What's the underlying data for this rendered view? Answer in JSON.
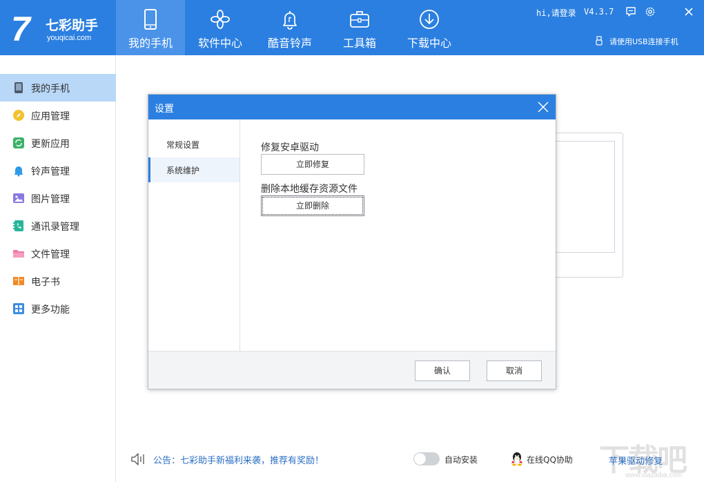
{
  "app": {
    "logo_mark": "7",
    "logo_name": "七彩助手",
    "logo_url": "youqicai.com"
  },
  "nav": [
    {
      "label": "我的手机",
      "icon": "phone-icon",
      "active": true
    },
    {
      "label": "软件中心",
      "icon": "apps-icon",
      "active": false
    },
    {
      "label": "酷音铃声",
      "icon": "bell-icon",
      "active": false
    },
    {
      "label": "工具箱",
      "icon": "toolbox-icon",
      "active": false
    },
    {
      "label": "下载中心",
      "icon": "download-icon",
      "active": false
    }
  ],
  "header": {
    "login": "hi,请登录",
    "version": "V4.3.7",
    "usb_hint": "请使用USB连接手机"
  },
  "sidebar": [
    {
      "label": "我的手机",
      "icon": "phone-icon",
      "color": "#4a5a6e",
      "active": true
    },
    {
      "label": "应用管理",
      "icon": "compass-icon",
      "color": "#f2c230"
    },
    {
      "label": "更新应用",
      "icon": "refresh-icon",
      "color": "#3bb26a"
    },
    {
      "label": "铃声管理",
      "icon": "bell-icon",
      "color": "#2f9ae8"
    },
    {
      "label": "图片管理",
      "icon": "image-icon",
      "color": "#8a7ae0"
    },
    {
      "label": "通讯录管理",
      "icon": "contacts-icon",
      "color": "#27b59a"
    },
    {
      "label": "文件管理",
      "icon": "folder-icon",
      "color": "#f07aa8"
    },
    {
      "label": "电子书",
      "icon": "book-icon",
      "color": "#f08a24"
    },
    {
      "label": "更多功能",
      "icon": "grid-icon",
      "color": "#3a8de0"
    }
  ],
  "dialog": {
    "title": "设置",
    "tabs": [
      {
        "label": "常规设置",
        "active": false
      },
      {
        "label": "系统维护",
        "active": true
      }
    ],
    "section1_label": "修复安卓驱动",
    "section1_button": "立即修复",
    "section2_label": "删除本地缓存资源文件",
    "section2_button": "立即删除",
    "ok": "确认",
    "cancel": "取消"
  },
  "footer": {
    "notice": "公告：七彩助手新福利来袭，推荐有奖励！",
    "auto_install": "自动安装",
    "auto_install_on": false,
    "qq_help": "在线QQ协助",
    "apple_fix": "苹果驱动修复",
    "watermark": "下载吧",
    "watermark_url": "www.xiazaiba.com"
  },
  "colors": {
    "brand": "#2b7fe0",
    "nav_active": "#4a93e8",
    "sidebar_active": "#b9d8f8",
    "link": "#2b6fc4"
  }
}
